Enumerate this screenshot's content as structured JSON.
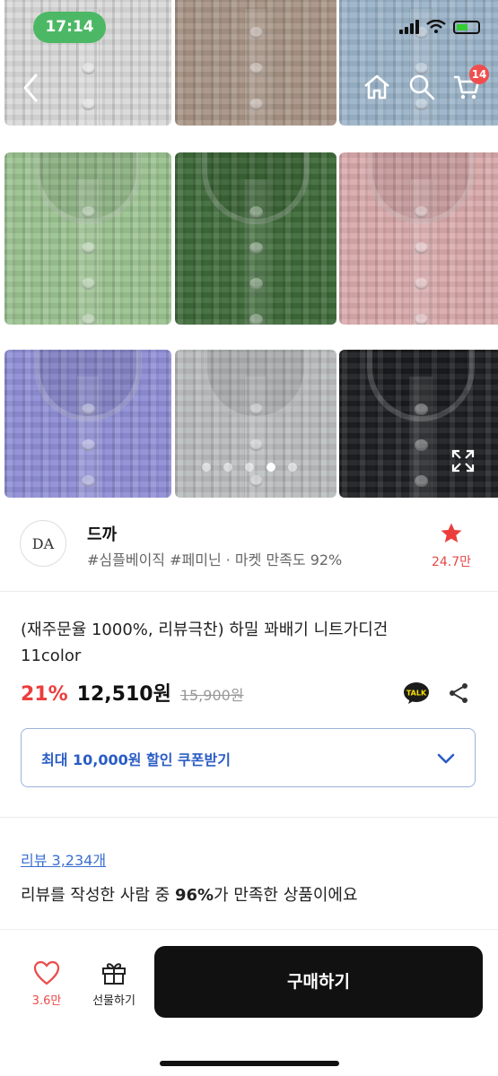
{
  "status_bar": {
    "time": "17:14"
  },
  "nav": {
    "cart_count": "14"
  },
  "gallery": {
    "swatches": [
      "#d9d9d9",
      "#a89486",
      "#9bb4c9",
      "#9bc290",
      "#3f6a3a",
      "#d9a9ab",
      "#8f8ed6",
      "#b9bcbd",
      "#1e1f22"
    ],
    "page_dots": 5,
    "active_dot": 3
  },
  "store": {
    "logo_text": "DA",
    "name": "드까",
    "tags": "#심플베이직 #페미닌 · 마켓 만족도 92%",
    "fav_count": "24.7만"
  },
  "product": {
    "title_line1": "(재주문율 1000%, 리뷰극찬) 하밀 꽈배기 니트가디건",
    "title_line2": "11color",
    "discount": "21%",
    "price": "12,510원",
    "original_price": "15,900원",
    "talk_label": "TALK"
  },
  "coupon": {
    "label": "최대 10,000원 할인 쿠폰받기"
  },
  "reviews": {
    "link": "리뷰 3,234개",
    "summary_before": "리뷰를 작성한 사람 중 ",
    "summary_percent": "96%",
    "summary_after": "가 만족한 상품이에요"
  },
  "bottom_bar": {
    "like_count": "3.6만",
    "gift_label": "선물하기",
    "buy_label": "구매하기"
  },
  "colors": {
    "accent_red": "#ec3d3d",
    "link_blue": "#3a6fd1",
    "coupon_blue": "#2a5cc5",
    "status_green": "#4cb865"
  }
}
